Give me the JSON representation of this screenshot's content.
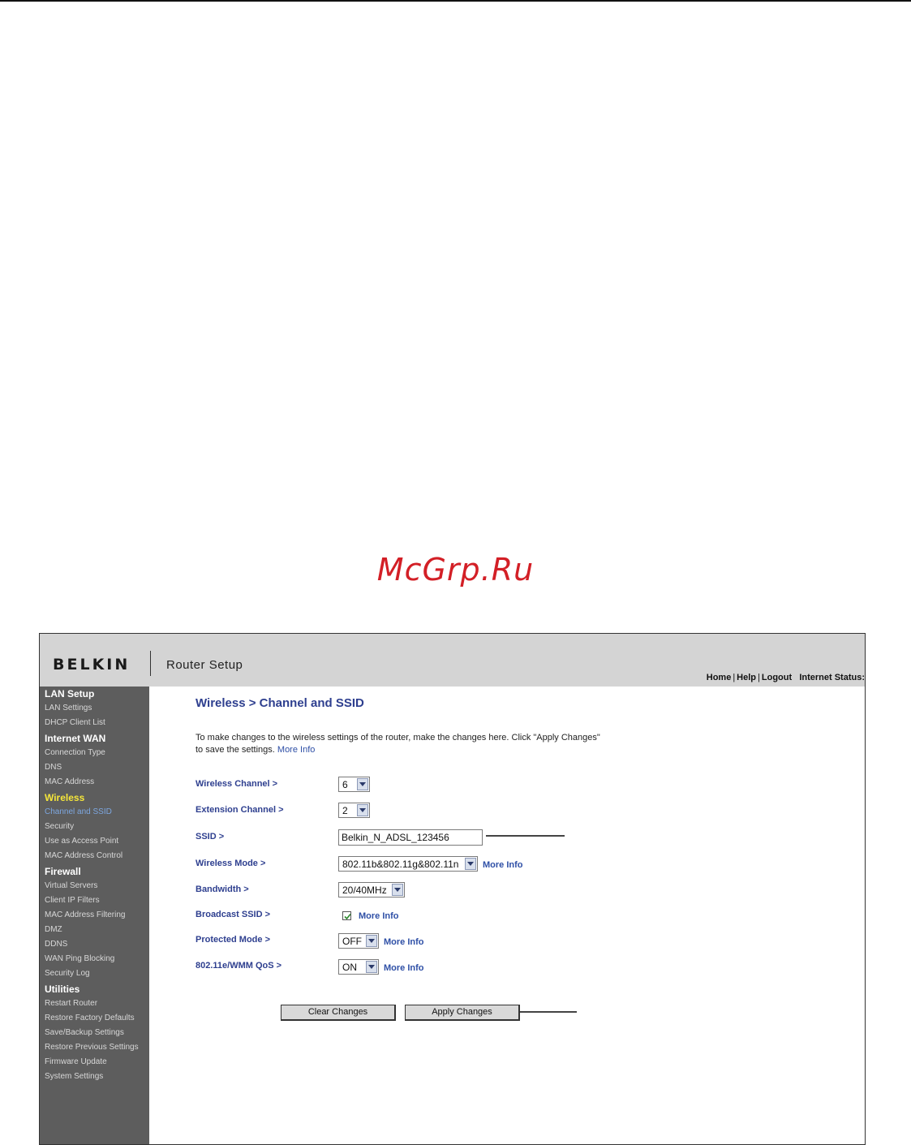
{
  "watermark": "McGrp.Ru",
  "header": {
    "logo": "BELKIN",
    "title": "Router Setup",
    "links": {
      "home": "Home",
      "help": "Help",
      "logout": "Logout",
      "internet_status": "Internet Status:",
      "separator": "|"
    }
  },
  "sidebar": {
    "items": [
      {
        "label": "LAN Setup",
        "type": "heading"
      },
      {
        "label": "LAN Settings"
      },
      {
        "label": "DHCP Client List"
      },
      {
        "label": "Internet WAN",
        "type": "heading"
      },
      {
        "label": "Connection Type"
      },
      {
        "label": "DNS"
      },
      {
        "label": "MAC Address"
      },
      {
        "label": "Wireless",
        "type": "heading",
        "active": true
      },
      {
        "label": "Channel and SSID",
        "current": true
      },
      {
        "label": "Security"
      },
      {
        "label": "Use as Access Point"
      },
      {
        "label": "MAC Address Control"
      },
      {
        "label": "Firewall",
        "type": "heading"
      },
      {
        "label": "Virtual Servers"
      },
      {
        "label": "Client IP Filters"
      },
      {
        "label": "MAC Address Filtering"
      },
      {
        "label": "DMZ"
      },
      {
        "label": "DDNS"
      },
      {
        "label": "WAN Ping Blocking"
      },
      {
        "label": "Security Log"
      },
      {
        "label": "Utilities",
        "type": "heading"
      },
      {
        "label": "Restart Router"
      },
      {
        "label": "Restore Factory Defaults"
      },
      {
        "label": "Save/Backup Settings"
      },
      {
        "label": "Restore Previous Settings"
      },
      {
        "label": "Firmware Update"
      },
      {
        "label": "System Settings"
      }
    ]
  },
  "main": {
    "title": "Wireless > Channel and SSID",
    "intro": "To make changes to the wireless settings of the router, make the changes here. Click \"Apply Changes\" to save the settings.",
    "intro_link": "More Info",
    "more_info": "More Info",
    "fields": {
      "wireless_channel": {
        "label": "Wireless Channel >",
        "value": "6"
      },
      "extension_channel": {
        "label": "Extension Channel >",
        "value": "2"
      },
      "ssid": {
        "label": "SSID >",
        "value": "Belkin_N_ADSL_123456"
      },
      "wireless_mode": {
        "label": "Wireless Mode >",
        "value": "802.11b&802.11g&802.11n"
      },
      "bandwidth": {
        "label": "Bandwidth >",
        "value": "20/40MHz"
      },
      "broadcast_ssid": {
        "label": "Broadcast SSID >",
        "checked": true
      },
      "protected_mode": {
        "label": "Protected Mode >",
        "value": "OFF"
      },
      "wmm_qos": {
        "label": "802.11e/WMM QoS >",
        "value": "ON"
      }
    },
    "buttons": {
      "clear": "Clear Changes",
      "apply": "Apply Changes"
    }
  },
  "colors": {
    "sidebar_bg": "#5d5d5d",
    "heading_active": "#f5e63a",
    "title_blue": "#2e3f8f",
    "link_blue": "#2e4fa6",
    "watermark_red": "#d31f26"
  }
}
